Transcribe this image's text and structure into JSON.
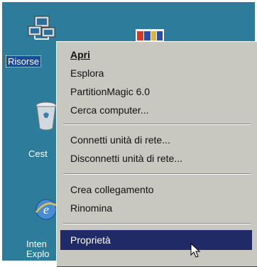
{
  "desktop": {
    "icons": [
      {
        "label": "Risorse",
        "icon": "network-computer-icon",
        "selected": true
      },
      {
        "label": "Cest",
        "icon": "recycle-bin-icon",
        "selected": false
      },
      {
        "label": "Inten\nExplo",
        "icon": "internet-explorer-icon",
        "selected": false
      },
      {
        "label": "",
        "icon": "partitionmagic-logo",
        "selected": false
      }
    ]
  },
  "menu": {
    "items": [
      {
        "label": "Apri",
        "underline": "A",
        "bold": true
      },
      {
        "label": "Esplora",
        "underline": "s"
      },
      {
        "label": "PartitionMagic 6.0",
        "underline": "P"
      },
      {
        "label": "Cerca computer...",
        "underline": "C"
      },
      {
        "label": "Connetti unità di rete...",
        "underline": "n"
      },
      {
        "label": "Disconnetti unità di rete...",
        "underline": "D"
      },
      {
        "label": "Crea collegamento",
        "underline": "g"
      },
      {
        "label": "Rinomina",
        "underline": "n"
      },
      {
        "label": "Proprietà",
        "underline": "P",
        "active": true
      }
    ]
  },
  "colors": {
    "desktop": "#2d7c9b",
    "menu": "#c8c8c0",
    "highlight": "#202a66"
  }
}
